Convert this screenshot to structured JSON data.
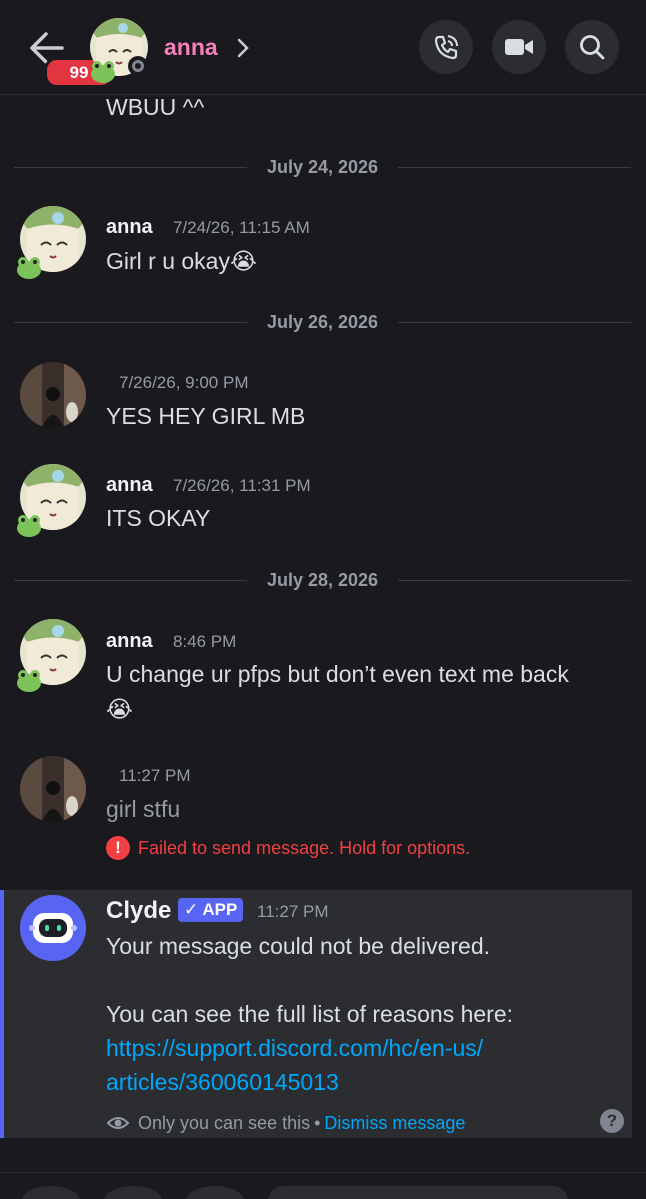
{
  "header": {
    "unread_badge": "99",
    "name": "anna",
    "accent": "#f47fb8"
  },
  "dividers": [
    "July 24, 2026",
    "July 26, 2026",
    "July 28, 2026"
  ],
  "top_fragment": "WBUU ^^",
  "messages": [
    {
      "author": "anna",
      "time": "7/24/26, 11:15 AM",
      "text": "Girl r u okay😭"
    },
    {
      "author": "",
      "time": "7/26/26, 9:00 PM",
      "text": "YES HEY GIRL MB"
    },
    {
      "author": "anna",
      "time": "7/26/26, 11:31 PM",
      "text": "ITS OKAY"
    },
    {
      "author": "anna",
      "time": "8:46 PM",
      "text_line1": "U change ur pfps  but don’t even text me back",
      "text_line2": "😭"
    },
    {
      "author": "",
      "time": "11:27 PM",
      "text": "girl stfu"
    }
  ],
  "error": {
    "text": "Failed to send message. Hold for options."
  },
  "clyde": {
    "name": "Clyde",
    "tag": "✓ APP",
    "time": "11:27 PM",
    "line1": "Your message could not be delivered.",
    "line2": "You can see the full list of reasons here:",
    "link_line1": "https://support.discord.com/hc/en-us/",
    "link_line2": "articles/360060145013",
    "only_you": "Only you can see this",
    "separator": "•",
    "dismiss": "Dismiss message",
    "help": "?"
  }
}
